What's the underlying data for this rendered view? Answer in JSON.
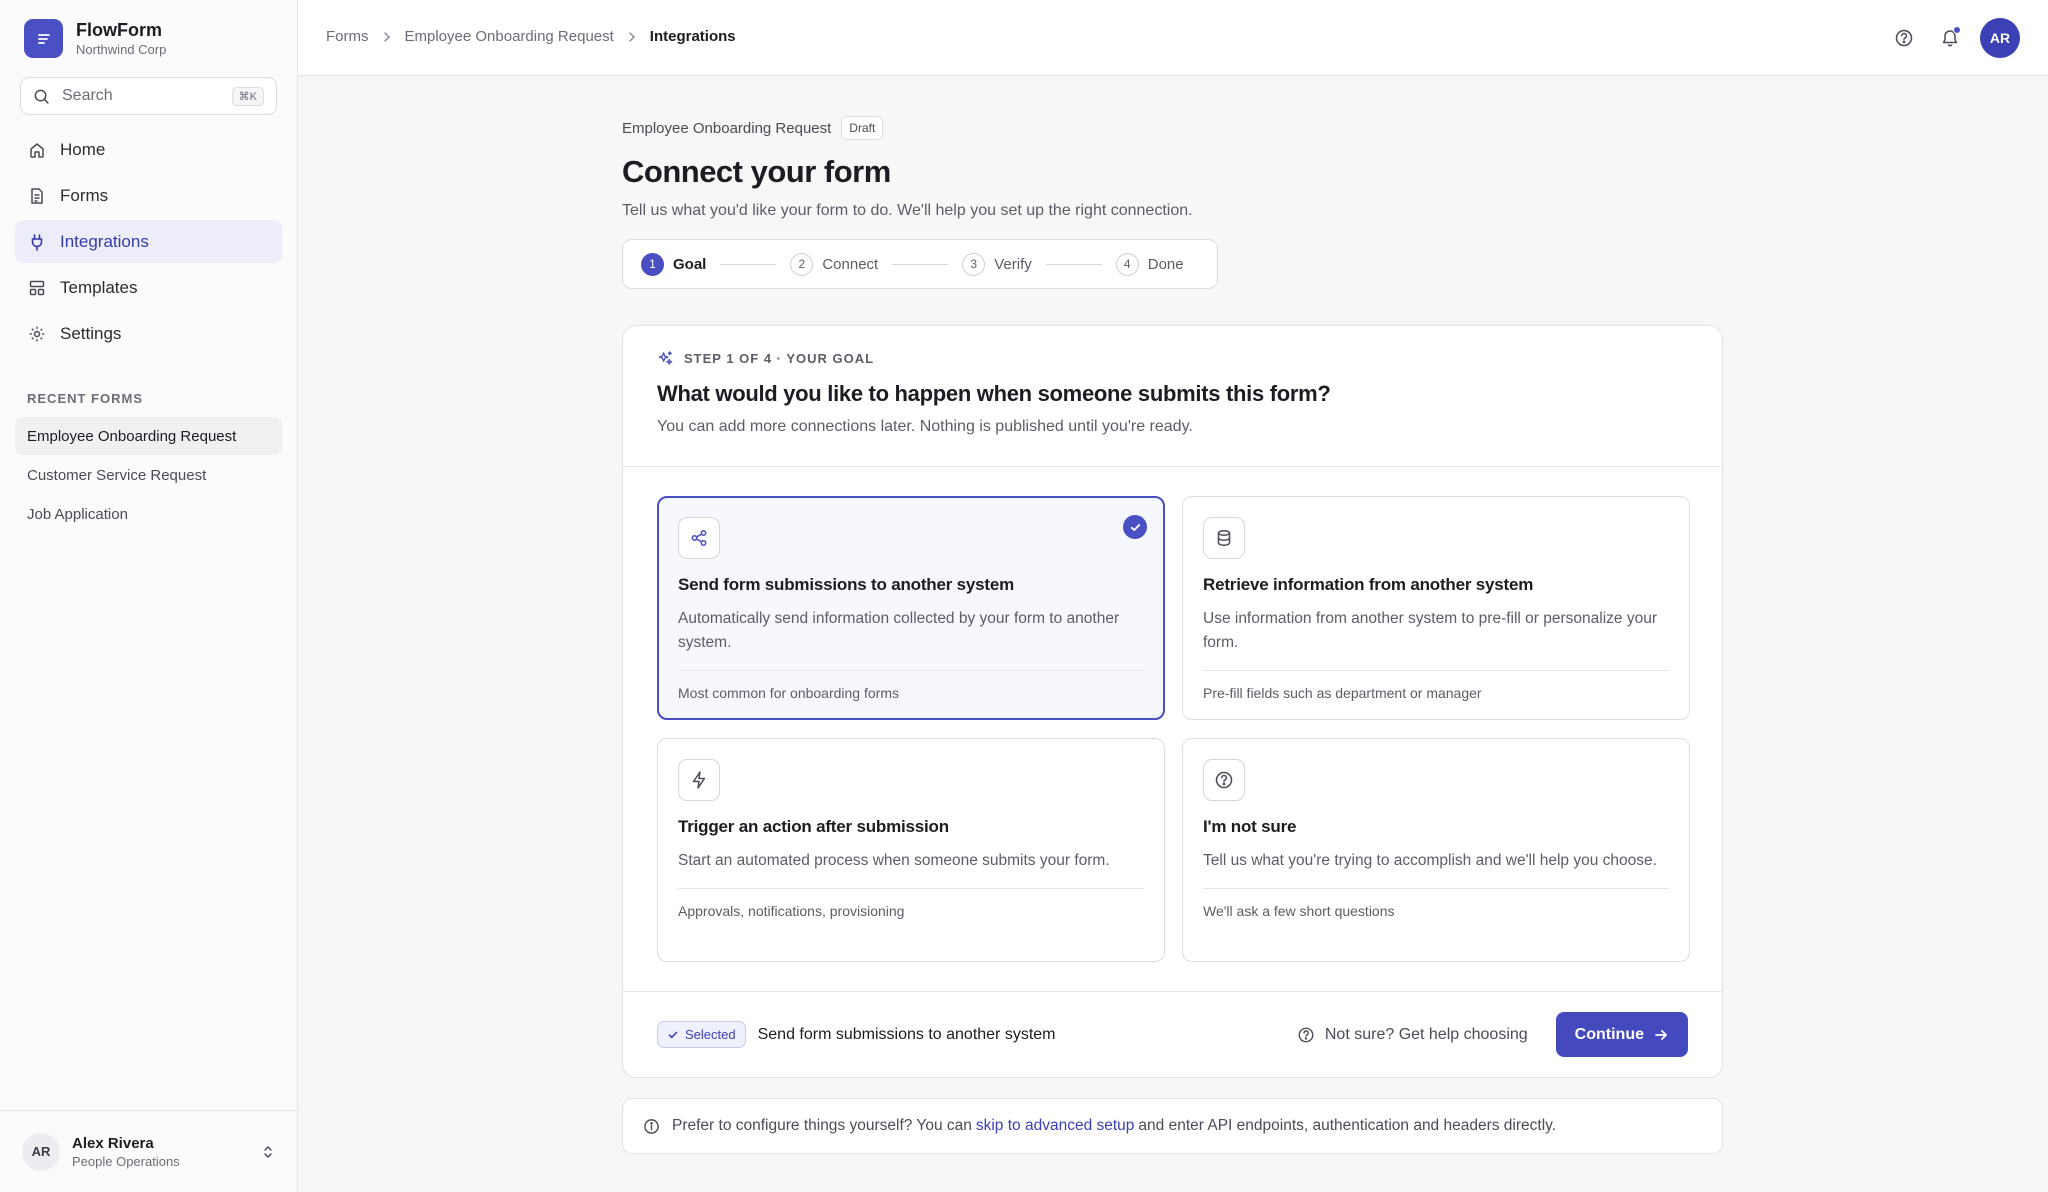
{
  "brand": {
    "name": "FlowForm",
    "org": "Northwind Corp"
  },
  "search": {
    "placeholder": "Search",
    "shortcut": "⌘K"
  },
  "nav": [
    {
      "label": "Home",
      "icon": "home-icon"
    },
    {
      "label": "Forms",
      "icon": "file-icon"
    },
    {
      "label": "Integrations",
      "icon": "plug-icon",
      "active": true
    },
    {
      "label": "Templates",
      "icon": "layout-icon"
    },
    {
      "label": "Settings",
      "icon": "gear-icon"
    }
  ],
  "recent": {
    "label": "RECENT FORMS",
    "items": [
      "Employee Onboarding Request",
      "Customer Service Request",
      "Job Application"
    ]
  },
  "user": {
    "initials": "AR",
    "name": "Alex Rivera",
    "role": "People Operations"
  },
  "breadcrumb": {
    "root": "Forms",
    "parent": "Employee Onboarding Request",
    "current": "Integrations"
  },
  "topbar": {
    "avatar": "AR"
  },
  "header": {
    "form_name": "Employee Onboarding Request",
    "status": "Draft",
    "title": "Connect your form",
    "subtitle": "Tell us what you'd like your form to do. We'll help you set up the right connection."
  },
  "stepper": [
    {
      "num": "1",
      "label": "Goal",
      "active": true
    },
    {
      "num": "2",
      "label": "Connect"
    },
    {
      "num": "3",
      "label": "Verify"
    },
    {
      "num": "4",
      "label": "Done"
    }
  ],
  "card": {
    "eyebrow": "STEP 1 OF 4 · YOUR GOAL",
    "title": "What would you like to happen when someone submits this form?",
    "subtitle": "You can add more connections later. Nothing is published until you're ready."
  },
  "options": [
    {
      "title": "Send form submissions to another system",
      "desc": "Automatically send information collected by your form to another system.",
      "foot": "Most common for onboarding forms",
      "icon": "share-icon"
    },
    {
      "title": "Retrieve information from another system",
      "desc": "Use information from another system to pre-fill or personalize your form.",
      "foot": "Pre-fill fields such as department or manager",
      "icon": "database-icon"
    },
    {
      "title": "Trigger an action after submission",
      "desc": "Start an automated process when someone submits your form.",
      "foot": "Approvals, notifications, provisioning",
      "icon": "bolt-icon"
    },
    {
      "title": "I'm not sure",
      "desc": "Tell us what you're trying to accomplish and we'll help you choose.",
      "foot": "We'll ask a few short questions",
      "icon": "question-icon"
    }
  ],
  "footer": {
    "badge": "Selected",
    "selected": "Send form submissions to another system",
    "help": "Not sure? Get help choosing",
    "continue": "Continue"
  },
  "info": {
    "before": "Prefer to configure things yourself? You can",
    "link": "skip to advanced setup",
    "after": "and enter API endpoints, authentication and headers directly."
  },
  "colors": {
    "accent": "#4a4fc4",
    "selected_bg": "#f7f7fe"
  }
}
